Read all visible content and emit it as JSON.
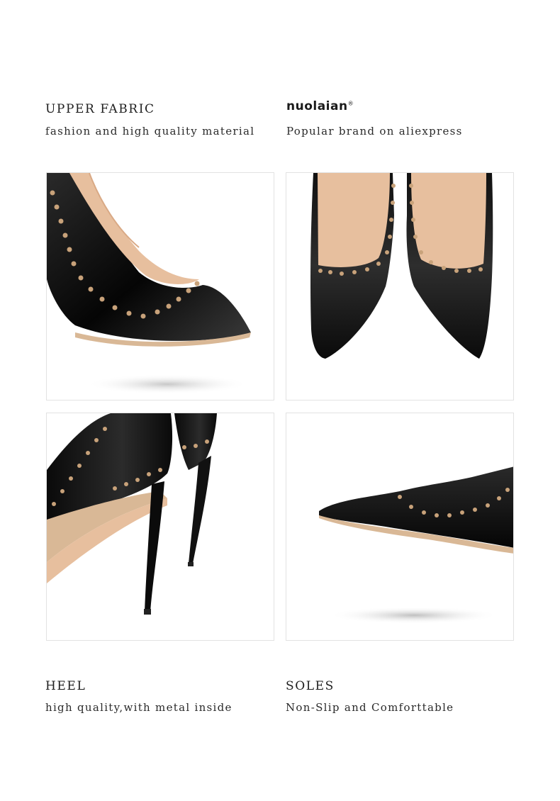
{
  "features": {
    "upper": {
      "title": "UPPER FABRIC",
      "subtitle": "fashion and high quality material"
    },
    "brand": {
      "logo_text": "nuolaian",
      "logo_mark": "®",
      "subtitle": "Popular brand on aliexpress"
    },
    "heel": {
      "title": "HEEL",
      "subtitle": "high quality,with metal inside"
    },
    "soles": {
      "title": "SOLES",
      "subtitle": "Non-Slip and Comforttable"
    }
  },
  "colors": {
    "shoe": "#0a0a0a",
    "lining": "#e7bf9e",
    "stud": "#c8a27a",
    "sole": "#d9b896"
  }
}
